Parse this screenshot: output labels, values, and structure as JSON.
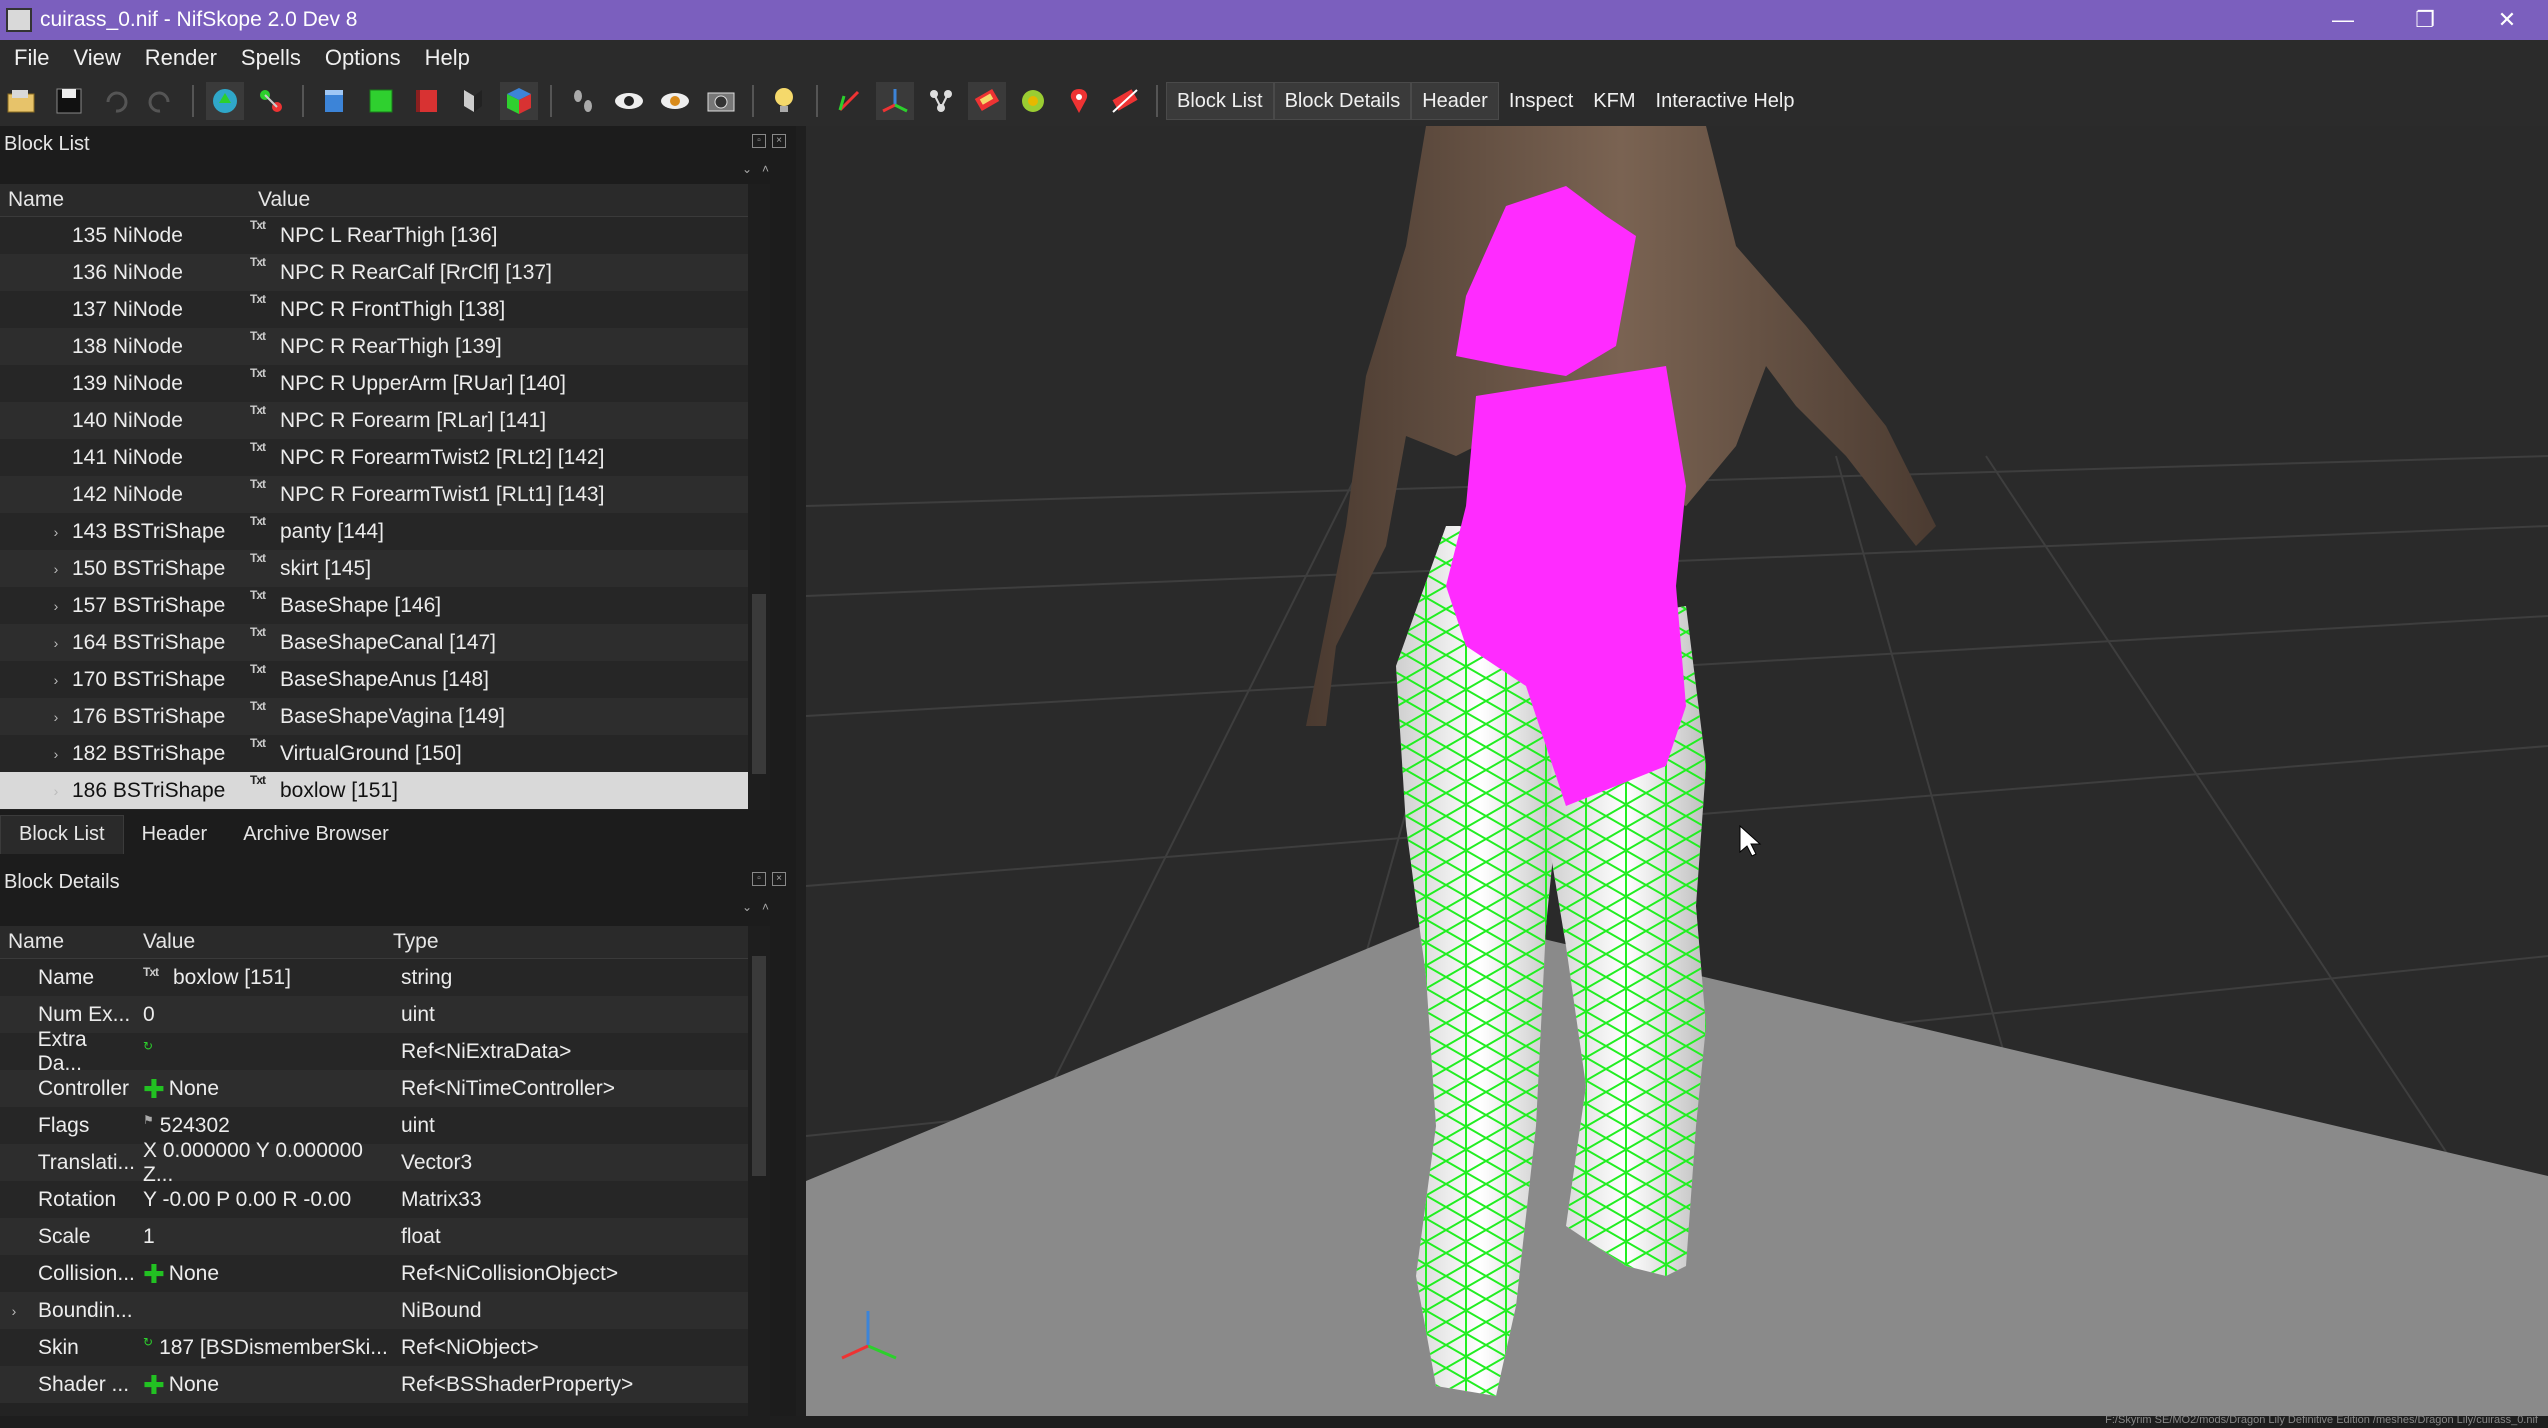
{
  "window": {
    "title": "cuirass_0.nif - NifSkope 2.0 Dev 8",
    "minimize": "—",
    "restore": "❐",
    "close": "✕"
  },
  "menu": [
    "File",
    "View",
    "Render",
    "Spells",
    "Options",
    "Help"
  ],
  "toolbar": {
    "text_buttons": [
      "Block List",
      "Block Details",
      "Header",
      "Inspect",
      "KFM",
      "Interactive Help"
    ]
  },
  "block_list": {
    "title": "Block List",
    "columns": [
      "Name",
      "Value"
    ],
    "rows": [
      {
        "expand": "",
        "name": "135 NiNode",
        "badge": "Txt",
        "value": "NPC L RearThigh [136]"
      },
      {
        "expand": "",
        "name": "136 NiNode",
        "badge": "Txt",
        "value": "NPC R RearCalf [RrClf] [137]"
      },
      {
        "expand": "",
        "name": "137 NiNode",
        "badge": "Txt",
        "value": "NPC R FrontThigh [138]"
      },
      {
        "expand": "",
        "name": "138 NiNode",
        "badge": "Txt",
        "value": "NPC R RearThigh [139]"
      },
      {
        "expand": "",
        "name": "139 NiNode",
        "badge": "Txt",
        "value": "NPC R UpperArm [RUar] [140]"
      },
      {
        "expand": "",
        "name": "140 NiNode",
        "badge": "Txt",
        "value": "NPC R Forearm [RLar] [141]"
      },
      {
        "expand": "",
        "name": "141 NiNode",
        "badge": "Txt",
        "value": "NPC R ForearmTwist2 [RLt2] [142]"
      },
      {
        "expand": "",
        "name": "142 NiNode",
        "badge": "Txt",
        "value": "NPC R ForearmTwist1 [RLt1] [143]"
      },
      {
        "expand": "›",
        "name": "143 BSTriShape",
        "badge": "Txt",
        "value": "panty [144]"
      },
      {
        "expand": "›",
        "name": "150 BSTriShape",
        "badge": "Txt",
        "value": "skirt [145]"
      },
      {
        "expand": "›",
        "name": "157 BSTriShape",
        "badge": "Txt",
        "value": "BaseShape [146]"
      },
      {
        "expand": "›",
        "name": "164 BSTriShape",
        "badge": "Txt",
        "value": "BaseShapeCanal [147]"
      },
      {
        "expand": "›",
        "name": "170 BSTriShape",
        "badge": "Txt",
        "value": "BaseShapeAnus [148]"
      },
      {
        "expand": "›",
        "name": "176 BSTriShape",
        "badge": "Txt",
        "value": "BaseShapeVagina [149]"
      },
      {
        "expand": "›",
        "name": "182 BSTriShape",
        "badge": "Txt",
        "value": "VirtualGround [150]"
      },
      {
        "expand": "›",
        "name": "186 BSTriShape",
        "badge": "Txt",
        "value": "boxlow [151]"
      }
    ],
    "selected_index": 15,
    "tabs": [
      "Block List",
      "Header",
      "Archive Browser"
    ]
  },
  "block_details": {
    "title": "Block Details",
    "columns": [
      "Name",
      "Value",
      "Type"
    ],
    "rows": [
      {
        "expand": "",
        "name": "Name",
        "icon": "Txt",
        "value": "boxlow [151]",
        "type": "string"
      },
      {
        "expand": "",
        "name": "Num Ex...",
        "icon": "",
        "value": "0",
        "type": "uint"
      },
      {
        "expand": "",
        "name": "Extra Da...",
        "icon": "link",
        "value": "",
        "type": "Ref<NiExtraData>"
      },
      {
        "expand": "",
        "name": "Controller",
        "icon": "plus",
        "value": "None",
        "type": "Ref<NiTimeController>"
      },
      {
        "expand": "",
        "name": "Flags",
        "icon": "flag",
        "value": "524302",
        "type": "uint"
      },
      {
        "expand": "",
        "name": "Translati...",
        "icon": "",
        "value": "X 0.000000 Y 0.000000 Z...",
        "type": "Vector3"
      },
      {
        "expand": "",
        "name": "Rotation",
        "icon": "",
        "value": "Y -0.00 P 0.00 R -0.00",
        "type": "Matrix33"
      },
      {
        "expand": "",
        "name": "Scale",
        "icon": "",
        "value": "1",
        "type": "float"
      },
      {
        "expand": "",
        "name": "Collision...",
        "icon": "plus",
        "value": "None",
        "type": "Ref<NiCollisionObject>"
      },
      {
        "expand": "›",
        "name": "Boundin...",
        "icon": "",
        "value": "",
        "type": "NiBound"
      },
      {
        "expand": "",
        "name": "Skin",
        "icon": "link",
        "value": "187 [BSDismemberSki...",
        "type": "Ref<NiObject>"
      },
      {
        "expand": "",
        "name": "Shader ...",
        "icon": "plus",
        "value": "None",
        "type": "Ref<BSShaderProperty>"
      }
    ]
  },
  "colors": {
    "title_bar": "#7b5fbe",
    "mesh_highlight": "#ff2bff",
    "wireframe": "#22ee22"
  },
  "statusbar": {
    "path": "F:/Skyrim SE/MO2/mods/Dragon Lily Definitive Edition /meshes/Dragon Lily/cuirass_0.nif"
  }
}
